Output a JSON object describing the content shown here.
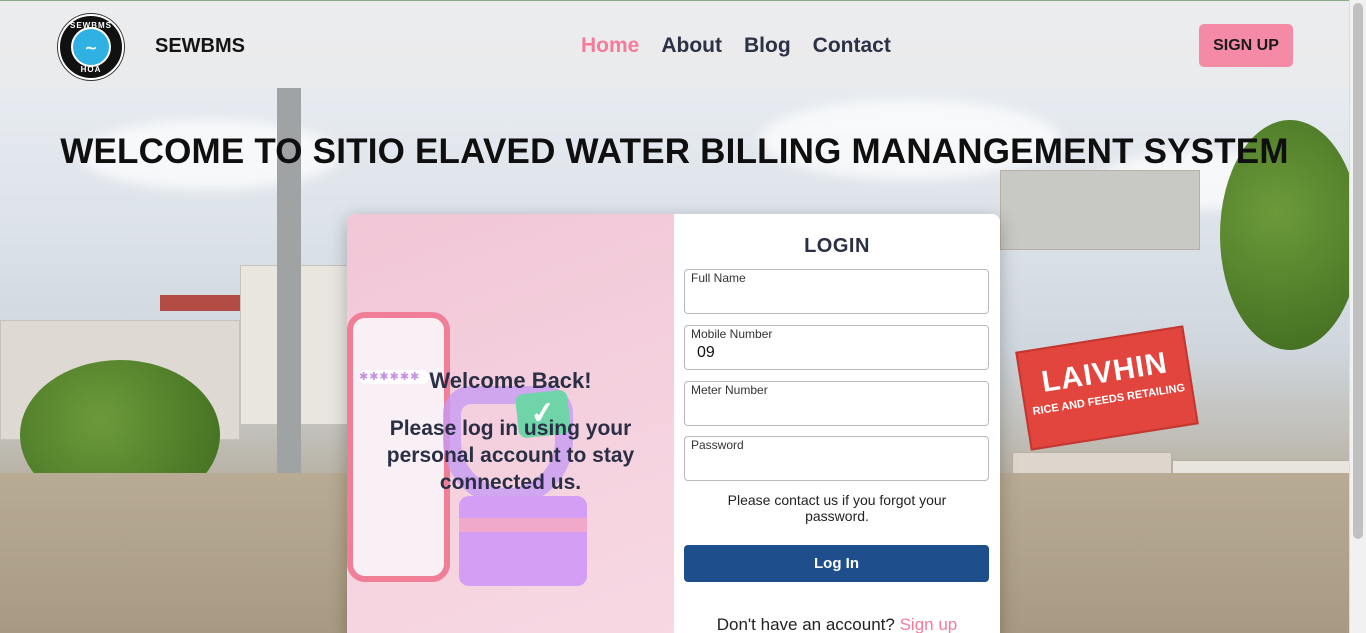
{
  "navbar": {
    "logo_top_text": "SEWBMS",
    "logo_bottom_text": "HOA",
    "brand": "SEWBMS",
    "links": [
      {
        "label": "Home",
        "active": true
      },
      {
        "label": "About",
        "active": false
      },
      {
        "label": "Blog",
        "active": false
      },
      {
        "label": "Contact",
        "active": false
      }
    ],
    "signup_label": "SIGN UP"
  },
  "headline": "WELCOME TO SITIO ELAVED WATER BILLING MANANGEMENT SYSTEM",
  "welcome_panel": {
    "title": "Welcome Back!",
    "message": "Please log in using your personal account to stay connected us."
  },
  "login_form": {
    "title": "LOGIN",
    "fields": [
      {
        "label": "Full Name",
        "value": ""
      },
      {
        "label": "Mobile Number",
        "value": "09"
      },
      {
        "label": "Meter Number",
        "value": ""
      },
      {
        "label": "Password",
        "value": ""
      }
    ],
    "forgot_text": "Please contact us if you forgot your password.",
    "login_button": "Log In",
    "no_account_text": "Don't have an account?",
    "signup_link": "Sign up"
  },
  "background_sign": {
    "big": "LAIVHIN",
    "small": "RICE AND FEEDS RETAILING"
  },
  "colors": {
    "accent_pink": "#f37c9b",
    "button_blue": "#1f4e8c",
    "text_dark": "#2b2f46"
  }
}
